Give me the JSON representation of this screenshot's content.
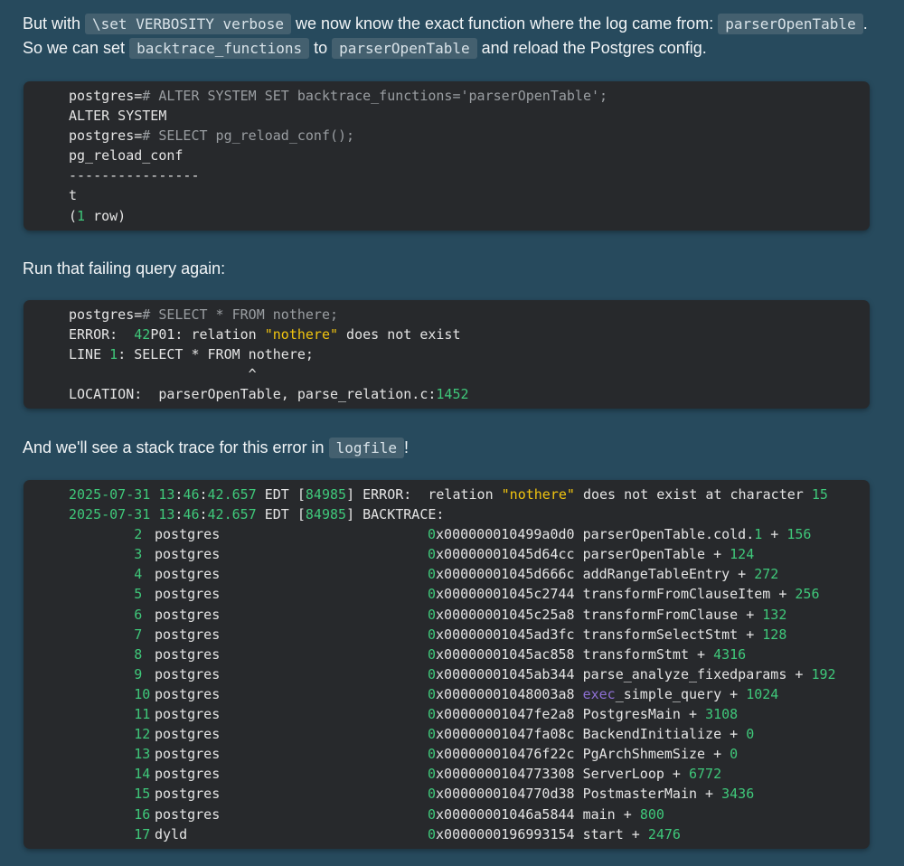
{
  "para1": {
    "t1": "But with ",
    "c1": "\\set VERBOSITY verbose",
    "t2": " we now know the exact function where the log came from: ",
    "c2": "parserOpenTable",
    "t3": ".",
    "t4": "So we can set ",
    "c3": "backtrace_functions",
    "t5": " to ",
    "c4": "parserOpenTable",
    "t6": " and reload the Postgres config."
  },
  "block1": {
    "l1_prompt": "postgres=",
    "l1_cmd": "# ALTER SYSTEM SET backtrace_functions='parserOpenTable';",
    "l2": "ALTER SYSTEM",
    "l3_prompt": "postgres=",
    "l3_cmd": "# SELECT pg_reload_conf();",
    "l4": "pg_reload_conf",
    "l5": "----------------",
    "l6": "t",
    "l7_a": "(",
    "l7_num": "1",
    "l7_b": " row)"
  },
  "para2": {
    "text": "Run that failing query again:"
  },
  "block2": {
    "l1_prompt": "postgres=",
    "l1_cmd": "# SELECT * FROM nothere;",
    "l2_a": "ERROR:  ",
    "l2_num": "42",
    "l2_b": "P01: relation ",
    "l2_str": "\"nothere\"",
    "l2_c": " does not exist",
    "l3_a": "LINE ",
    "l3_num": "1",
    "l3_b": ": SELECT * FROM nothere;",
    "l4": "                      ^",
    "l5_a": "LOCATION:  parserOpenTable, parse_relation.c:",
    "l5_num": "1452"
  },
  "para3": {
    "t1": "And we'll see a stack trace for this error in ",
    "c1": "logfile",
    "t2": "!"
  },
  "block3": {
    "h1_date": "2025-07-31",
    "h1_h": "13",
    "h1_m": "46",
    "h1_s": "42.657",
    "h1_tz": " EDT [",
    "h1_pid": "84985",
    "h1_msg": "] ERROR:  relation ",
    "h1_str": "\"nothere\"",
    "h1_tail": " does not exist at character ",
    "h1_char": "15",
    "h2_date": "2025-07-31",
    "h2_h": "13",
    "h2_m": "46",
    "h2_s": "42.657",
    "h2_tz": " EDT [",
    "h2_pid": "84985",
    "h2_msg": "] BACKTRACE:",
    "rows": [
      {
        "n": "2",
        "bin": "postgres",
        "hexlead": "0",
        "hex": "x000000010499a0d0",
        "fn": "parserOpenTable.cold.",
        "fnnum": "1",
        "off": "156"
      },
      {
        "n": "3",
        "bin": "postgres",
        "hexlead": "0",
        "hex": "x00000001045d64cc",
        "fn": "parserOpenTable",
        "fnnum": "",
        "off": "124"
      },
      {
        "n": "4",
        "bin": "postgres",
        "hexlead": "0",
        "hex": "x00000001045d666c",
        "fn": "addRangeTableEntry",
        "fnnum": "",
        "off": "272"
      },
      {
        "n": "5",
        "bin": "postgres",
        "hexlead": "0",
        "hex": "x00000001045c2744",
        "fn": "transformFromClauseItem",
        "fnnum": "",
        "off": "256"
      },
      {
        "n": "6",
        "bin": "postgres",
        "hexlead": "0",
        "hex": "x00000001045c25a8",
        "fn": "transformFromClause",
        "fnnum": "",
        "off": "132"
      },
      {
        "n": "7",
        "bin": "postgres",
        "hexlead": "0",
        "hex": "x00000001045ad3fc",
        "fn": "transformSelectStmt",
        "fnnum": "",
        "off": "128"
      },
      {
        "n": "8",
        "bin": "postgres",
        "hexlead": "0",
        "hex": "x00000001045ac858",
        "fn": "transformStmt",
        "fnnum": "",
        "off": "4316"
      },
      {
        "n": "9",
        "bin": "postgres",
        "hexlead": "0",
        "hex": "x00000001045ab344",
        "fn": "parse_analyze_fixedparams",
        "fnnum": "",
        "off": "192"
      },
      {
        "n": "10",
        "bin": "postgres",
        "hexlead": "0",
        "hex": "x00000001048003a8",
        "fnkw": "exec",
        "fn": "_simple_query",
        "fnnum": "",
        "off": "1024"
      },
      {
        "n": "11",
        "bin": "postgres",
        "hexlead": "0",
        "hex": "x00000001047fe2a8",
        "fn": "PostgresMain",
        "fnnum": "",
        "off": "3108"
      },
      {
        "n": "12",
        "bin": "postgres",
        "hexlead": "0",
        "hex": "x00000001047fa08c",
        "fn": "BackendInitialize",
        "fnnum": "",
        "off": "0"
      },
      {
        "n": "13",
        "bin": "postgres",
        "hexlead": "0",
        "hex": "x000000010476f22c",
        "fn": "PgArchShmemSize",
        "fnnum": "",
        "off": "0"
      },
      {
        "n": "14",
        "bin": "postgres",
        "hexlead": "0",
        "hex": "x0000000104773308",
        "fn": "ServerLoop",
        "fnnum": "",
        "off": "6772"
      },
      {
        "n": "15",
        "bin": "postgres",
        "hexlead": "0",
        "hex": "x0000000104770d38",
        "fn": "PostmasterMain",
        "fnnum": "",
        "off": "3436"
      },
      {
        "n": "16",
        "bin": "postgres",
        "hexlead": "0",
        "hex": "x00000001046a5844",
        "fn": "main",
        "fnnum": "",
        "off": "800"
      },
      {
        "n": "17",
        "bin": "dyld",
        "hexlead": "0",
        "hex": "x0000000196993154",
        "fn": "start",
        "fnnum": "",
        "off": "2476"
      }
    ]
  },
  "colors": {
    "page_bg": "#274a5d",
    "code_bg": "#27292c",
    "number": "#3fc87a",
    "string": "#f1c40f",
    "keyword": "#8e6fd4",
    "comment": "#9a9ea2"
  }
}
